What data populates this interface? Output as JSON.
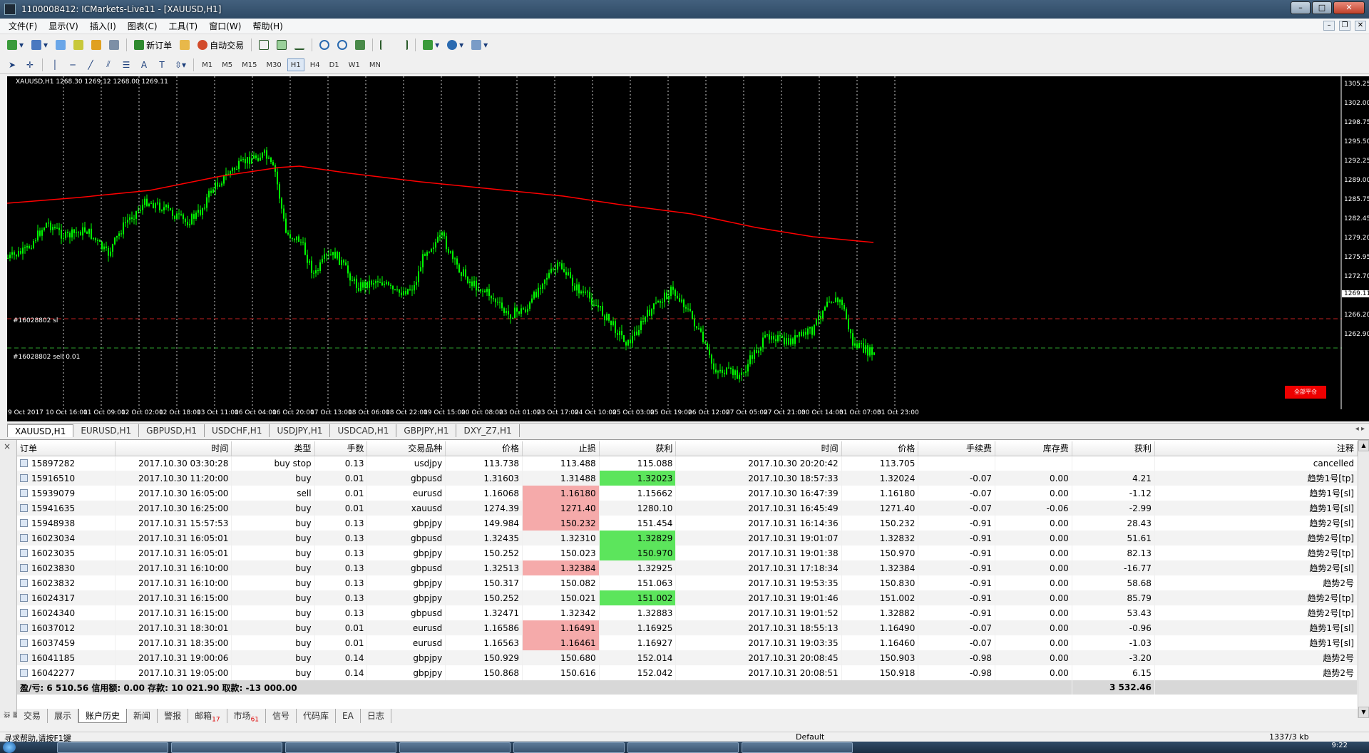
{
  "window": {
    "title": "1100008412: ICMarkets-Live11 - [XAUUSD,H1]"
  },
  "menu": [
    "文件(F)",
    "显示(V)",
    "插入(I)",
    "图表(C)",
    "工具(T)",
    "窗口(W)",
    "帮助(H)"
  ],
  "toolbar": {
    "new_order": "新订单",
    "auto_trade": "自动交易"
  },
  "timeframes": [
    "M1",
    "M5",
    "M15",
    "M30",
    "H1",
    "H4",
    "D1",
    "W1",
    "MN"
  ],
  "active_timeframe": "H1",
  "chart": {
    "header": "XAUUSD,H1  1268.30 1269.12 1268.00 1269.11",
    "sl_label": "#16028802 sl",
    "sell_label": "#16028802 sell 0.01",
    "current_price": "1269.11",
    "red_button": "全部平仓",
    "price_ticks": [
      "1305.25",
      "1302.00",
      "1298.75",
      "1295.50",
      "1292.25",
      "1289.00",
      "1285.75",
      "1282.45",
      "1279.20",
      "1275.95",
      "1272.70",
      "1266.20",
      "1262.90"
    ],
    "time_ticks": [
      "9 Oct 2017",
      "10 Oct 16:00",
      "11 Oct 09:00",
      "12 Oct 02:00",
      "12 Oct 18:00",
      "13 Oct 11:00",
      "16 Oct 04:00",
      "16 Oct 20:00",
      "17 Oct 13:00",
      "18 Oct 06:00",
      "18 Oct 22:00",
      "19 Oct 15:00",
      "20 Oct 08:00",
      "23 Oct 01:00",
      "23 Oct 17:00",
      "24 Oct 10:00",
      "25 Oct 03:00",
      "25 Oct 19:00",
      "26 Oct 12:00",
      "27 Oct 05:00",
      "27 Oct 21:00",
      "30 Oct 14:00",
      "31 Oct 07:00",
      "31 Oct 23:00"
    ],
    "colors": {
      "candle": "#00ff00",
      "ma": "#ff0000",
      "grid": "#ffffff",
      "background": "#000000"
    }
  },
  "chart_tabs": [
    "XAUUSD,H1",
    "EURUSD,H1",
    "GBPUSD,H1",
    "USDCHF,H1",
    "USDJPY,H1",
    "USDCAD,H1",
    "GBPJPY,H1",
    "DXY_Z7,H1"
  ],
  "table": {
    "headers": [
      "订单",
      "时间",
      "类型",
      "手数",
      "交易品种",
      "价格",
      "止损",
      "获利",
      "时间",
      "价格",
      "手续费",
      "库存费",
      "获利",
      "注释"
    ],
    "rows": [
      [
        "15897282",
        "2017.10.30 03:30:28",
        "buy stop",
        "0.13",
        "usdjpy",
        "113.738",
        "113.488",
        "115.088",
        "2017.10.30 20:20:42",
        "113.705",
        "",
        "",
        "",
        "cancelled"
      ],
      [
        "15916510",
        "2017.10.30 11:20:00",
        "buy",
        "0.01",
        "gbpusd",
        "1.31603",
        "1.31488",
        "1.32023",
        "2017.10.30 18:57:33",
        "1.32024",
        "-0.07",
        "0.00",
        "4.21",
        "趋势1号[tp]"
      ],
      [
        "15939079",
        "2017.10.30 16:05:00",
        "sell",
        "0.01",
        "eurusd",
        "1.16068",
        "1.16180",
        "1.15662",
        "2017.10.30 16:47:39",
        "1.16180",
        "-0.07",
        "0.00",
        "-1.12",
        "趋势1号[sl]"
      ],
      [
        "15941635",
        "2017.10.30 16:25:00",
        "buy",
        "0.01",
        "xauusd",
        "1274.39",
        "1271.40",
        "1280.10",
        "2017.10.31 16:45:49",
        "1271.40",
        "-0.07",
        "-0.06",
        "-2.99",
        "趋势1号[sl]"
      ],
      [
        "15948938",
        "2017.10.31 15:57:53",
        "buy",
        "0.13",
        "gbpjpy",
        "149.984",
        "150.232",
        "151.454",
        "2017.10.31 16:14:36",
        "150.232",
        "-0.91",
        "0.00",
        "28.43",
        "趋势2号[sl]"
      ],
      [
        "16023034",
        "2017.10.31 16:05:01",
        "buy",
        "0.13",
        "gbpusd",
        "1.32435",
        "1.32310",
        "1.32829",
        "2017.10.31 19:01:07",
        "1.32832",
        "-0.91",
        "0.00",
        "51.61",
        "趋势2号[tp]"
      ],
      [
        "16023035",
        "2017.10.31 16:05:01",
        "buy",
        "0.13",
        "gbpjpy",
        "150.252",
        "150.023",
        "150.970",
        "2017.10.31 19:01:38",
        "150.970",
        "-0.91",
        "0.00",
        "82.13",
        "趋势2号[tp]"
      ],
      [
        "16023830",
        "2017.10.31 16:10:00",
        "buy",
        "0.13",
        "gbpusd",
        "1.32513",
        "1.32384",
        "1.32925",
        "2017.10.31 17:18:34",
        "1.32384",
        "-0.91",
        "0.00",
        "-16.77",
        "趋势2号[sl]"
      ],
      [
        "16023832",
        "2017.10.31 16:10:00",
        "buy",
        "0.13",
        "gbpjpy",
        "150.317",
        "150.082",
        "151.063",
        "2017.10.31 19:53:35",
        "150.830",
        "-0.91",
        "0.00",
        "58.68",
        "趋势2号"
      ],
      [
        "16024317",
        "2017.10.31 16:15:00",
        "buy",
        "0.13",
        "gbpjpy",
        "150.252",
        "150.021",
        "151.002",
        "2017.10.31 19:01:46",
        "151.002",
        "-0.91",
        "0.00",
        "85.79",
        "趋势2号[tp]"
      ],
      [
        "16024340",
        "2017.10.31 16:15:00",
        "buy",
        "0.13",
        "gbpusd",
        "1.32471",
        "1.32342",
        "1.32883",
        "2017.10.31 19:01:52",
        "1.32882",
        "-0.91",
        "0.00",
        "53.43",
        "趋势2号[tp]"
      ],
      [
        "16037012",
        "2017.10.31 18:30:01",
        "buy",
        "0.01",
        "eurusd",
        "1.16586",
        "1.16491",
        "1.16925",
        "2017.10.31 18:55:13",
        "1.16490",
        "-0.07",
        "0.00",
        "-0.96",
        "趋势1号[sl]"
      ],
      [
        "16037459",
        "2017.10.31 18:35:00",
        "buy",
        "0.01",
        "eurusd",
        "1.16563",
        "1.16461",
        "1.16927",
        "2017.10.31 19:03:35",
        "1.16460",
        "-0.07",
        "0.00",
        "-1.03",
        "趋势1号[sl]"
      ],
      [
        "16041185",
        "2017.10.31 19:00:06",
        "buy",
        "0.14",
        "gbpjpy",
        "150.929",
        "150.680",
        "152.014",
        "2017.10.31 20:08:45",
        "150.903",
        "-0.98",
        "0.00",
        "-3.20",
        "趋势2号"
      ],
      [
        "16042277",
        "2017.10.31 19:05:00",
        "buy",
        "0.14",
        "gbpjpy",
        "150.868",
        "150.616",
        "152.042",
        "2017.10.31 20:08:51",
        "150.918",
        "-0.98",
        "0.00",
        "6.15",
        "趋势2号"
      ]
    ],
    "highlights": {
      "red": [
        [
          2,
          6
        ],
        [
          3,
          6
        ],
        [
          4,
          6
        ],
        [
          7,
          6
        ],
        [
          11,
          6
        ],
        [
          12,
          6
        ]
      ],
      "green": [
        [
          1,
          7
        ],
        [
          5,
          7
        ],
        [
          6,
          7
        ],
        [
          9,
          7
        ]
      ]
    },
    "summary": {
      "text": "盈/亏: 6 510.56  信用额: 0.00  存款: 10 021.90  取款: -13 000.00",
      "total": "3 532.46"
    }
  },
  "terminal_tabs": [
    {
      "label": "交易",
      "badge": ""
    },
    {
      "label": "展示",
      "badge": ""
    },
    {
      "label": "账户历史",
      "badge": ""
    },
    {
      "label": "新闻",
      "badge": ""
    },
    {
      "label": "警报",
      "badge": ""
    },
    {
      "label": "邮箱",
      "badge": "17"
    },
    {
      "label": "市场",
      "badge": "61"
    },
    {
      "label": "信号",
      "badge": ""
    },
    {
      "label": "代码库",
      "badge": ""
    },
    {
      "label": "EA",
      "badge": ""
    },
    {
      "label": "日志",
      "badge": ""
    }
  ],
  "active_terminal_tab": "账户历史",
  "status": {
    "help": "寻求帮助,请按F1键",
    "profile": "Default",
    "traffic": "1337/3 kb"
  },
  "terminal_side_label": "终端",
  "taskbar": {
    "clock": "9:22"
  }
}
